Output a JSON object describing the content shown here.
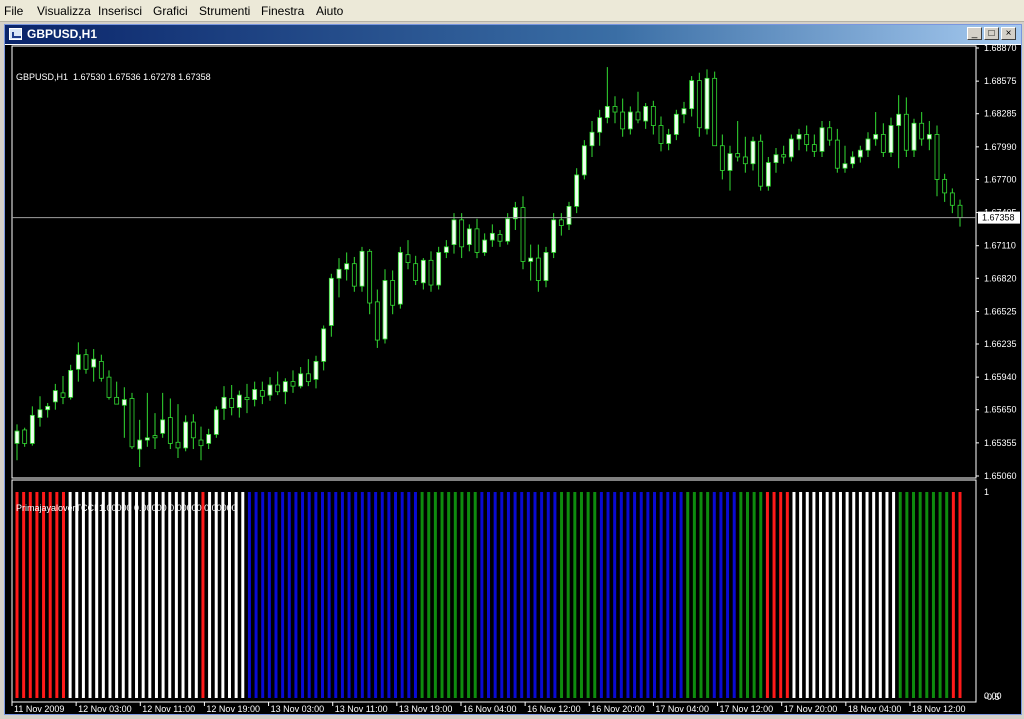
{
  "menu": [
    "File",
    "Visualizza",
    "Inserisci",
    "Grafici",
    "Strumenti",
    "Finestra",
    "Aiuto"
  ],
  "window": {
    "title": "GBPUSD,H1",
    "buttons": [
      "_",
      "□",
      "×"
    ]
  },
  "main_chart": {
    "info": "GBPUSD,H1  1.67530 1.67536 1.67278 1.67358",
    "price_labels": [
      "1.68870",
      "1.68575",
      "1.68285",
      "1.67990",
      "1.67700",
      "1.67405",
      "1.67110",
      "1.66820",
      "1.66525",
      "1.66235",
      "1.65940",
      "1.65650",
      "1.65355",
      "1.65060"
    ],
    "current_price": "1.67358",
    "colors": {
      "background": "#000000",
      "candle_bull": "#f0fff0",
      "candle_bear": "#000000",
      "wick": "#33dd33",
      "bid_line": "#a0a0a0"
    }
  },
  "indicator": {
    "info": "PrimajayaloverTCCI 1.00000 0.00000 0.00000 0.00000",
    "scale_labels": [
      "1",
      "0.00",
      "-0.5"
    ],
    "colors": {
      "red": "#ff1a1a",
      "white": "#ffffff",
      "blue": "#0a0ad2",
      "green": "#0e8c0e"
    }
  },
  "time_axis": [
    "11 Nov 2009",
    "12 Nov 03:00",
    "12 Nov 11:00",
    "12 Nov 19:00",
    "13 Nov 03:00",
    "13 Nov 11:00",
    "13 Nov 19:00",
    "16 Nov 04:00",
    "16 Nov 12:00",
    "16 Nov 20:00",
    "17 Nov 04:00",
    "17 Nov 12:00",
    "17 Nov 20:00",
    "18 Nov 04:00",
    "18 Nov 12:00"
  ],
  "chart_data": {
    "type": "candlestick",
    "symbol": "GBPUSD",
    "timeframe": "H1",
    "ylim": [
      1.6506,
      1.6887
    ],
    "candles": [
      [
        1.6535,
        1.6552,
        1.652,
        1.6546
      ],
      [
        1.6547,
        1.6549,
        1.6532,
        1.6535
      ],
      [
        1.6535,
        1.6568,
        1.6533,
        1.656
      ],
      [
        1.6558,
        1.6577,
        1.655,
        1.6565
      ],
      [
        1.6565,
        1.6571,
        1.6558,
        1.6568
      ],
      [
        1.6572,
        1.6588,
        1.6565,
        1.6582
      ],
      [
        1.658,
        1.6595,
        1.657,
        1.6576
      ],
      [
        1.6576,
        1.6605,
        1.6574,
        1.66
      ],
      [
        1.6601,
        1.6625,
        1.659,
        1.6614
      ],
      [
        1.6614,
        1.6619,
        1.6597,
        1.6601
      ],
      [
        1.6603,
        1.6619,
        1.659,
        1.661
      ],
      [
        1.6608,
        1.6614,
        1.659,
        1.6593
      ],
      [
        1.6594,
        1.66,
        1.6574,
        1.6576
      ],
      [
        1.6576,
        1.659,
        1.657,
        1.657
      ],
      [
        1.6569,
        1.6585,
        1.654,
        1.6574
      ],
      [
        1.6575,
        1.658,
        1.653,
        1.6532
      ],
      [
        1.653,
        1.6556,
        1.6514,
        1.6538
      ],
      [
        1.6538,
        1.658,
        1.6532,
        1.654
      ],
      [
        1.6542,
        1.6562,
        1.653,
        1.654
      ],
      [
        1.6544,
        1.658,
        1.654,
        1.6556
      ],
      [
        1.6558,
        1.6575,
        1.653,
        1.6535
      ],
      [
        1.6536,
        1.657,
        1.6522,
        1.6531
      ],
      [
        1.6531,
        1.656,
        1.6528,
        1.6554
      ],
      [
        1.6554,
        1.6561,
        1.653,
        1.654
      ],
      [
        1.6538,
        1.655,
        1.652,
        1.6533
      ],
      [
        1.6535,
        1.6548,
        1.653,
        1.6543
      ],
      [
        1.6543,
        1.6568,
        1.654,
        1.6565
      ],
      [
        1.6566,
        1.6586,
        1.6556,
        1.6576
      ],
      [
        1.6575,
        1.6587,
        1.656,
        1.6567
      ],
      [
        1.6567,
        1.6582,
        1.6558,
        1.6578
      ],
      [
        1.6576,
        1.6588,
        1.6562,
        1.6574
      ],
      [
        1.6574,
        1.659,
        1.6568,
        1.6583
      ],
      [
        1.6582,
        1.659,
        1.657,
        1.6577
      ],
      [
        1.6578,
        1.6594,
        1.6573,
        1.6587
      ],
      [
        1.6587,
        1.6599,
        1.6578,
        1.6581
      ],
      [
        1.6581,
        1.6593,
        1.657,
        1.659
      ],
      [
        1.659,
        1.66,
        1.658,
        1.6586
      ],
      [
        1.6586,
        1.6603,
        1.6584,
        1.6597
      ],
      [
        1.6597,
        1.661,
        1.6586,
        1.659
      ],
      [
        1.6592,
        1.6613,
        1.6584,
        1.6608
      ],
      [
        1.6608,
        1.664,
        1.66,
        1.6637
      ],
      [
        1.664,
        1.6686,
        1.663,
        1.6682
      ],
      [
        1.6682,
        1.67,
        1.6665,
        1.669
      ],
      [
        1.669,
        1.6705,
        1.668,
        1.6695
      ],
      [
        1.6695,
        1.6701,
        1.667,
        1.6675
      ],
      [
        1.6675,
        1.671,
        1.667,
        1.6706
      ],
      [
        1.6706,
        1.6708,
        1.665,
        1.666
      ],
      [
        1.6661,
        1.6672,
        1.662,
        1.6627
      ],
      [
        1.6628,
        1.669,
        1.6624,
        1.668
      ],
      [
        1.668,
        1.6689,
        1.665,
        1.6658
      ],
      [
        1.6659,
        1.671,
        1.6655,
        1.6705
      ],
      [
        1.6703,
        1.6716,
        1.669,
        1.6696
      ],
      [
        1.6695,
        1.6702,
        1.6676,
        1.668
      ],
      [
        1.6678,
        1.67,
        1.6672,
        1.6698
      ],
      [
        1.6698,
        1.6706,
        1.667,
        1.6676
      ],
      [
        1.6676,
        1.671,
        1.6672,
        1.6705
      ],
      [
        1.6705,
        1.6716,
        1.67,
        1.671
      ],
      [
        1.6712,
        1.674,
        1.6704,
        1.6734
      ],
      [
        1.6734,
        1.674,
        1.67,
        1.671
      ],
      [
        1.6712,
        1.673,
        1.6706,
        1.6726
      ],
      [
        1.6726,
        1.6735,
        1.67,
        1.6705
      ],
      [
        1.6705,
        1.6722,
        1.6702,
        1.6716
      ],
      [
        1.6716,
        1.673,
        1.671,
        1.6722
      ],
      [
        1.6721,
        1.6725,
        1.671,
        1.6715
      ],
      [
        1.6715,
        1.674,
        1.6712,
        1.6735
      ],
      [
        1.6735,
        1.675,
        1.6725,
        1.6745
      ],
      [
        1.6745,
        1.6755,
        1.669,
        1.6697
      ],
      [
        1.6697,
        1.6712,
        1.668,
        1.67
      ],
      [
        1.67,
        1.6712,
        1.667,
        1.668
      ],
      [
        1.668,
        1.671,
        1.6674,
        1.6705
      ],
      [
        1.6705,
        1.674,
        1.67,
        1.6734
      ],
      [
        1.6734,
        1.674,
        1.672,
        1.6729
      ],
      [
        1.673,
        1.675,
        1.6725,
        1.6746
      ],
      [
        1.6746,
        1.678,
        1.674,
        1.6774
      ],
      [
        1.6774,
        1.6805,
        1.677,
        1.68
      ],
      [
        1.68,
        1.6822,
        1.679,
        1.6812
      ],
      [
        1.6812,
        1.6832,
        1.68,
        1.6825
      ],
      [
        1.6825,
        1.687,
        1.682,
        1.6835
      ],
      [
        1.6835,
        1.6844,
        1.682,
        1.683
      ],
      [
        1.683,
        1.6842,
        1.6808,
        1.6815
      ],
      [
        1.6815,
        1.6835,
        1.681,
        1.683
      ],
      [
        1.683,
        1.6848,
        1.682,
        1.6823
      ],
      [
        1.6822,
        1.6838,
        1.6815,
        1.6835
      ],
      [
        1.6835,
        1.684,
        1.681,
        1.6818
      ],
      [
        1.6818,
        1.6826,
        1.6795,
        1.6802
      ],
      [
        1.6802,
        1.6815,
        1.6796,
        1.681
      ],
      [
        1.681,
        1.6832,
        1.6805,
        1.6828
      ],
      [
        1.6828,
        1.6839,
        1.682,
        1.6833
      ],
      [
        1.6833,
        1.6862,
        1.6826,
        1.6858
      ],
      [
        1.6858,
        1.6865,
        1.6808,
        1.6816
      ],
      [
        1.6815,
        1.6868,
        1.681,
        1.686
      ],
      [
        1.686,
        1.6866,
        1.68,
        1.68
      ],
      [
        1.68,
        1.681,
        1.677,
        1.6778
      ],
      [
        1.6778,
        1.68,
        1.676,
        1.6793
      ],
      [
        1.6793,
        1.6822,
        1.6786,
        1.679
      ],
      [
        1.679,
        1.6808,
        1.6776,
        1.6784
      ],
      [
        1.6784,
        1.6808,
        1.6778,
        1.6804
      ],
      [
        1.6804,
        1.681,
        1.676,
        1.6764
      ],
      [
        1.6764,
        1.679,
        1.676,
        1.6785
      ],
      [
        1.6785,
        1.6798,
        1.6776,
        1.6792
      ],
      [
        1.6792,
        1.68,
        1.6784,
        1.679
      ],
      [
        1.679,
        1.681,
        1.6786,
        1.6806
      ],
      [
        1.6806,
        1.6815,
        1.6796,
        1.681
      ],
      [
        1.681,
        1.6818,
        1.6795,
        1.6801
      ],
      [
        1.6801,
        1.681,
        1.679,
        1.6795
      ],
      [
        1.6795,
        1.6822,
        1.679,
        1.6816
      ],
      [
        1.6816,
        1.6822,
        1.68,
        1.6805
      ],
      [
        1.6805,
        1.6815,
        1.6776,
        1.678
      ],
      [
        1.678,
        1.68,
        1.6776,
        1.6784
      ],
      [
        1.6784,
        1.6795,
        1.678,
        1.679
      ],
      [
        1.679,
        1.68,
        1.6785,
        1.6796
      ],
      [
        1.6796,
        1.6812,
        1.679,
        1.6806
      ],
      [
        1.6806,
        1.683,
        1.68,
        1.681
      ],
      [
        1.681,
        1.682,
        1.679,
        1.6794
      ],
      [
        1.6794,
        1.6825,
        1.679,
        1.6818
      ],
      [
        1.6818,
        1.6845,
        1.678,
        1.6828
      ],
      [
        1.6828,
        1.6843,
        1.679,
        1.6796
      ],
      [
        1.6796,
        1.6824,
        1.679,
        1.682
      ],
      [
        1.682,
        1.683,
        1.68,
        1.6806
      ],
      [
        1.6806,
        1.6822,
        1.6796,
        1.681
      ],
      [
        1.681,
        1.6818,
        1.6755,
        1.677
      ],
      [
        1.677,
        1.6775,
        1.675,
        1.6758
      ],
      [
        1.6758,
        1.6762,
        1.674,
        1.6747
      ],
      [
        1.6747,
        1.6752,
        1.6728,
        1.6736
      ]
    ],
    "indicator_histogram": {
      "name": "PrimajayaloverTCCI",
      "values": [
        1,
        0
      ],
      "bar_colors": [
        "red",
        "red",
        "red",
        "red",
        "red",
        "red",
        "red",
        "red",
        "white",
        "white",
        "white",
        "white",
        "white",
        "white",
        "white",
        "white",
        "white",
        "white",
        "white",
        "white",
        "white",
        "white",
        "white",
        "white",
        "white",
        "white",
        "white",
        "white",
        "red",
        "white",
        "white",
        "white",
        "white",
        "white",
        "white",
        "blue",
        "blue",
        "blue",
        "blue",
        "blue",
        "blue",
        "blue",
        "blue",
        "blue",
        "blue",
        "blue",
        "blue",
        "blue",
        "blue",
        "blue",
        "blue",
        "blue",
        "blue",
        "blue",
        "blue",
        "blue",
        "blue",
        "blue",
        "blue",
        "blue",
        "blue",
        "green",
        "green",
        "green",
        "green",
        "green",
        "green",
        "green",
        "green",
        "green",
        "blue",
        "blue",
        "blue",
        "blue",
        "blue",
        "blue",
        "blue",
        "blue",
        "blue",
        "blue",
        "blue",
        "blue",
        "green",
        "green",
        "green",
        "green",
        "green",
        "green",
        "blue",
        "blue",
        "blue",
        "blue",
        "blue",
        "blue",
        "blue",
        "blue",
        "blue",
        "blue",
        "blue",
        "blue",
        "blue",
        "green",
        "green",
        "green",
        "green",
        "blue",
        "blue",
        "blue",
        "blue",
        "green",
        "green",
        "green",
        "green",
        "red",
        "red",
        "red",
        "red",
        "white",
        "white",
        "white",
        "white",
        "white",
        "white",
        "white",
        "white",
        "white",
        "white",
        "white",
        "white",
        "white",
        "white",
        "white",
        "white",
        "green",
        "green",
        "green",
        "green",
        "green",
        "green",
        "green",
        "green",
        "red",
        "red"
      ]
    }
  }
}
